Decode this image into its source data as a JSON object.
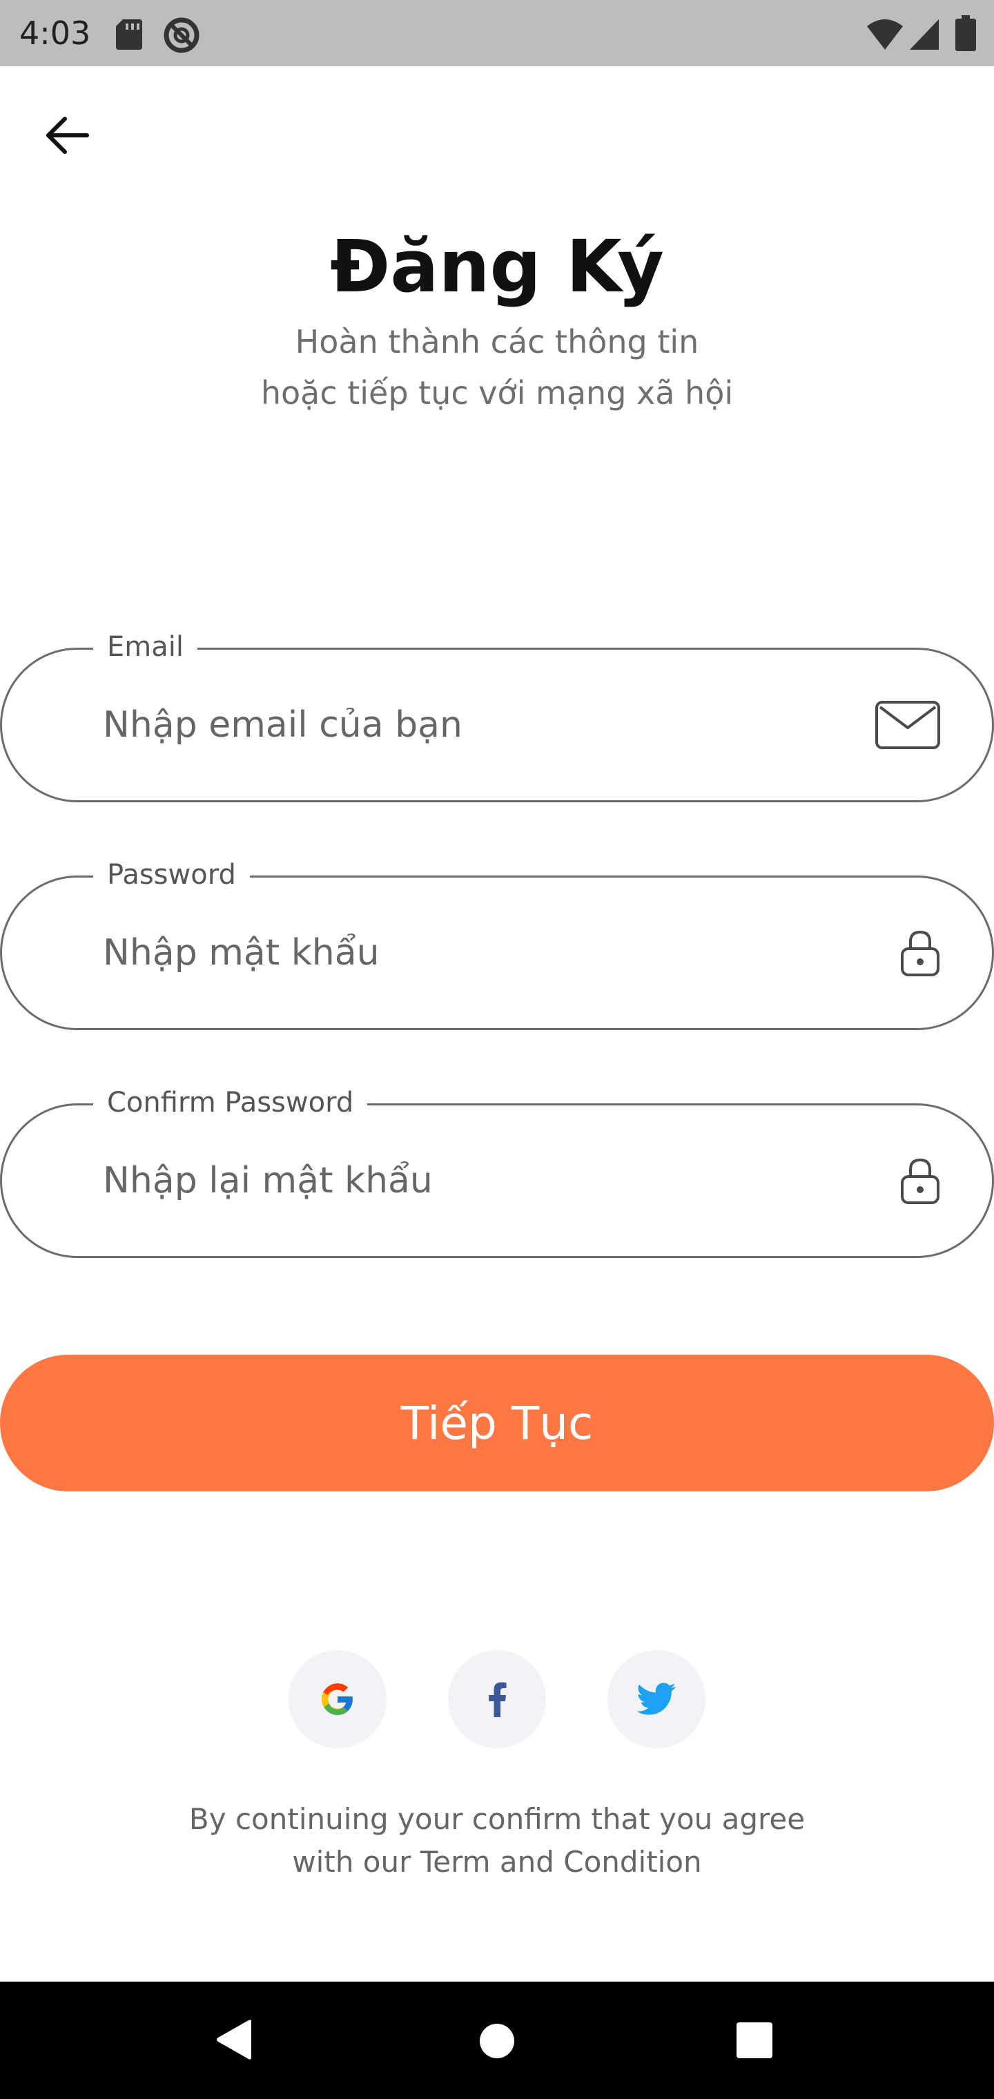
{
  "status_bar": {
    "time": "4:03",
    "icons": [
      "sd-card-icon",
      "do-not-disturb-icon",
      "wifi-icon",
      "signal-icon",
      "battery-icon"
    ]
  },
  "header": {
    "back_icon": "arrow-left-icon"
  },
  "title": {
    "heading": "Đăng Ký",
    "subtitle_line1": "Hoàn thành các thông tin",
    "subtitle_line2": "hoặc tiếp tục với mạng xã hội"
  },
  "form": {
    "email": {
      "label": "Email",
      "placeholder": "Nhập email của bạn",
      "value": "",
      "icon": "mail-icon"
    },
    "password": {
      "label": "Password",
      "placeholder": "Nhập mật khẩu",
      "value": "",
      "icon": "lock-icon"
    },
    "confirm_password": {
      "label": "Confirm Password",
      "placeholder": "Nhập lại mật khẩu",
      "value": "",
      "icon": "lock-icon"
    },
    "submit_label": "Tiếp Tục"
  },
  "social": {
    "providers": [
      "google-icon",
      "facebook-icon",
      "twitter-icon"
    ]
  },
  "terms": {
    "line1": "By continuing your confirm that you agree",
    "line2": "with our Term and Condition"
  },
  "colors": {
    "accent": "#ff7743",
    "status_bar": "#bdbdbd",
    "social_bg": "#f1f3f6",
    "facebook": "#3b5998",
    "twitter": "#1da1f2"
  }
}
